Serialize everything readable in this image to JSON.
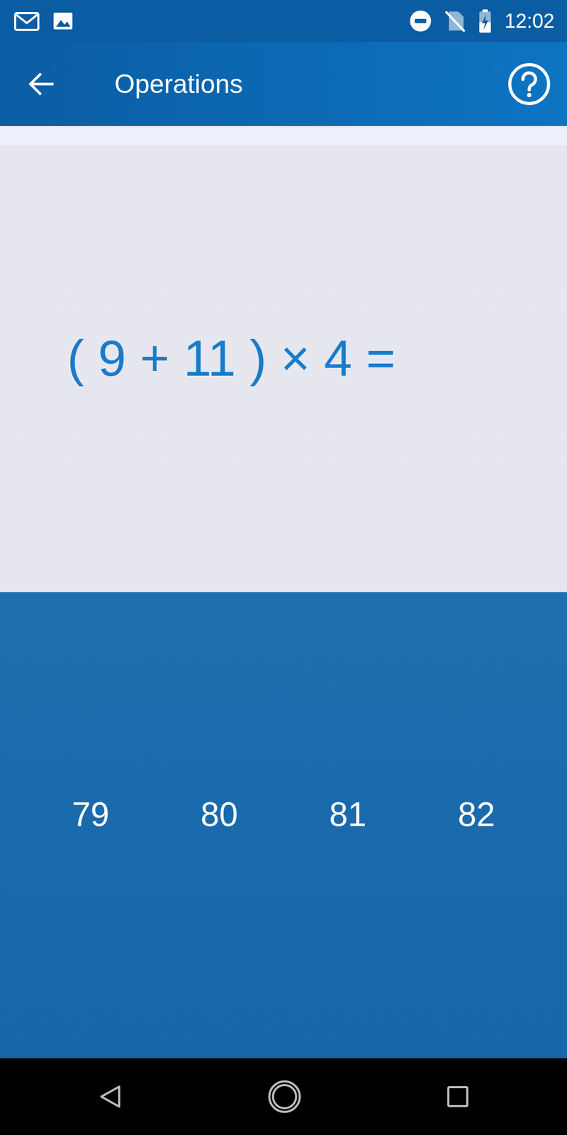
{
  "status_bar": {
    "time": "12:02"
  },
  "app_bar": {
    "title": "Operations"
  },
  "question": {
    "expression": "( 9 + 11 ) × 4 ="
  },
  "answers": [
    {
      "label": "79"
    },
    {
      "label": "80"
    },
    {
      "label": "81"
    },
    {
      "label": "82"
    }
  ]
}
